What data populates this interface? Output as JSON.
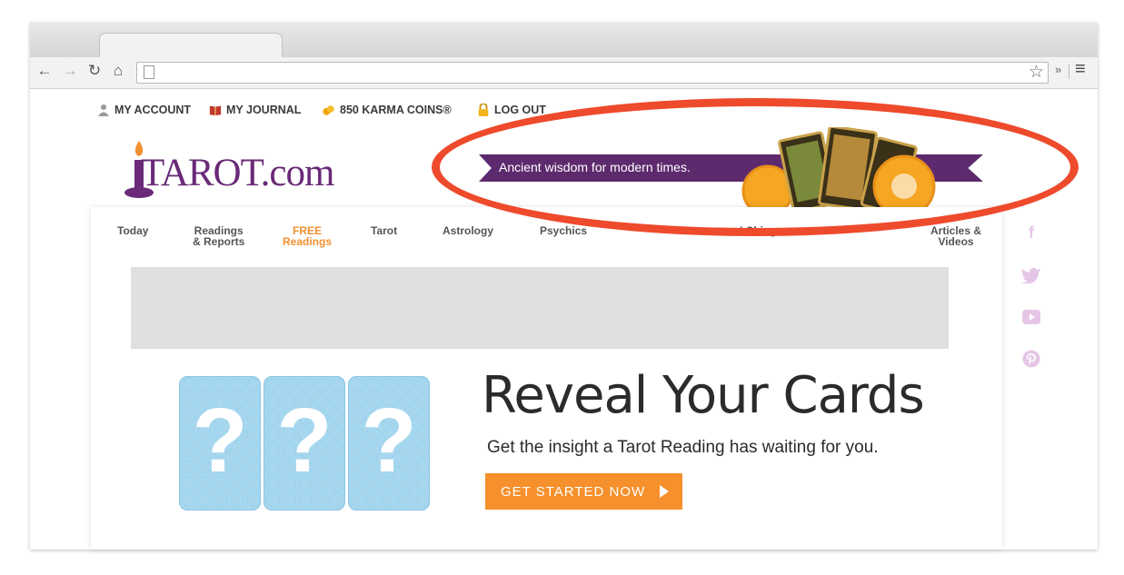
{
  "browser": {
    "url": ""
  },
  "topbar": {
    "my_account": "MY ACCOUNT",
    "my_journal": "MY JOURNAL",
    "karma_coins": "850 KARMA COINS®",
    "log_out": "LOG OUT"
  },
  "brand": {
    "logo_text": "TAROT.com"
  },
  "banner": {
    "tagline": "Ancient wisdom for modern times."
  },
  "nav": {
    "items": [
      {
        "line1": "Today",
        "line2": ""
      },
      {
        "line1": "Readings",
        "line2": "& Reports"
      },
      {
        "line1": "FREE",
        "line2": "Readings"
      },
      {
        "line1": "Tarot",
        "line2": ""
      },
      {
        "line1": "Astrology",
        "line2": ""
      },
      {
        "line1": "Psychics",
        "line2": ""
      },
      {
        "line1": "I Ching",
        "line2": ""
      },
      {
        "line1": "Articles &",
        "line2": "Videos"
      }
    ]
  },
  "social": {
    "facebook": "f"
  },
  "hero": {
    "card_symbol": "?",
    "title": "Reveal Your Cards",
    "subtitle": "Get the insight a Tarot Reading has waiting for you.",
    "cta_label": "GET STARTED NOW"
  },
  "colors": {
    "brand_purple": "#6a2a78",
    "accent_orange": "#f5902c",
    "highlight_red": "#ee4a2c",
    "card_blue": "#a6d7ef"
  }
}
